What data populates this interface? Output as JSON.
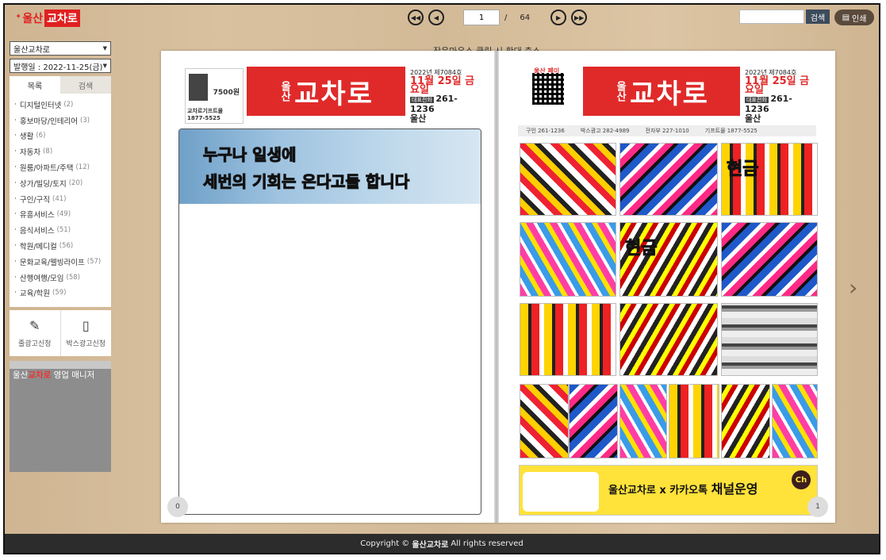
{
  "logo": {
    "mark": "ᐩ",
    "ulsan": "울산",
    "box": "교차로"
  },
  "pager": {
    "first": "◀◀",
    "prev": "◀",
    "current": "1",
    "slash": "/",
    "total": "64",
    "next": "▶",
    "last": "▶▶"
  },
  "toolbar": {
    "search_label": "검색",
    "print_label": "인쇄"
  },
  "sidebar": {
    "region_select": "울산교차로",
    "date_select": "발행일 : 2022-11-25(금)",
    "tabs": {
      "list": "목록",
      "search": "검색"
    },
    "categories": [
      {
        "label": "디지털인터넷",
        "count": "(2)"
      },
      {
        "label": "홍보마당/인테리어",
        "count": "(3)"
      },
      {
        "label": "생활",
        "count": "(6)"
      },
      {
        "label": "자동차",
        "count": "(8)"
      },
      {
        "label": "원룸/아파트/주택",
        "count": "(12)"
      },
      {
        "label": "상가/빌딩/토지",
        "count": "(20)"
      },
      {
        "label": "구인/구직",
        "count": "(41)"
      },
      {
        "label": "유흥서비스",
        "count": "(49)"
      },
      {
        "label": "음식서비스",
        "count": "(51)"
      },
      {
        "label": "학원/메디컬",
        "count": "(56)"
      },
      {
        "label": "문화교육/웰빙라이프",
        "count": "(57)"
      },
      {
        "label": "산행여행/모임",
        "count": "(58)"
      },
      {
        "label": "교육/학원",
        "count": "(59)"
      }
    ],
    "apply": {
      "line_ad": "줄광고신청",
      "box_ad": "박스광고신청"
    },
    "manager": {
      "prefix": "울산",
      "brand": "교차로",
      "suffix": " 영업 매니저"
    }
  },
  "hint": "작은마우스 클릭 시 확대 축소",
  "left_page": {
    "page_number": "0",
    "ad": {
      "price_tag": "7500원",
      "shop": "교차로기프트몰",
      "tel": "1877-5525"
    },
    "masthead": {
      "small": "울산",
      "big": "교차로",
      "issue": "2022년 제7084호",
      "date": "11월 25일 금요일",
      "tel_label": "대표전화",
      "tel": "261-1236",
      "region": "울산"
    },
    "banner": {
      "line1": "누구나 일생에",
      "line2": "세번의 기회는 온다고들 합니다"
    }
  },
  "right_page": {
    "page_number": "1",
    "qr_label": "울산 페이",
    "masthead": {
      "small": "울산",
      "big": "교차로",
      "issue": "2022년 제7084호",
      "date": "11월 25일 금요일",
      "tel_label": "대표전화",
      "tel": "261-1236",
      "region": "울산"
    },
    "strip1": [
      "구인 261-1236",
      "박스광고 282-4989",
      "전자부 227-1010",
      "기프트몰 1877-5525"
    ],
    "ads": [
      "",
      "",
      "현금",
      "",
      "현금",
      "",
      "",
      "",
      "",
      "",
      "",
      "",
      "",
      "",
      ""
    ],
    "kakao": {
      "prefix": "울산교차로 x 카카오톡 ",
      "big": "채널운영",
      "ch": "Ch"
    }
  },
  "footer": {
    "copyright": "Copyright © ",
    "brand": "울산교차로",
    "rights": " All rights reserved"
  }
}
